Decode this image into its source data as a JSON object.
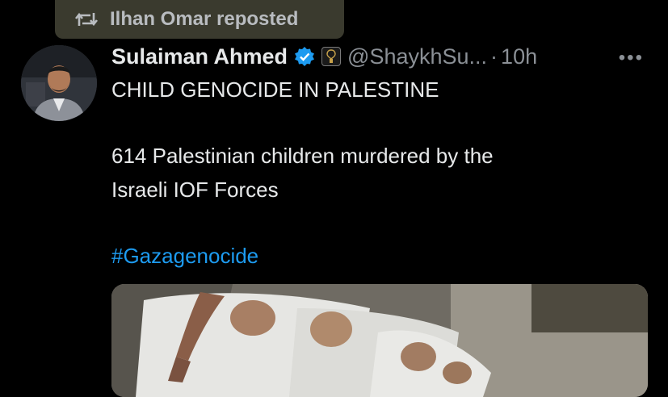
{
  "repost": {
    "label": "Ilhan Omar reposted",
    "icon": "repost-icon"
  },
  "author": {
    "name": "Sulaiman Ahmed",
    "handle": "@ShaykhSu...",
    "separator": "·",
    "time": "10h",
    "verified": true,
    "verified_color": "#1d9bf0"
  },
  "menu": {
    "more_label": "•••"
  },
  "post": {
    "line1": "CHILD GENOCIDE IN PALESTINE",
    "line2a": "614 Palestinian children murdered by the",
    "line2b": "Israeli IOF Forces",
    "hashtag": "#Gazagenocide"
  },
  "colors": {
    "background": "#000000",
    "text": "#e7e9ea",
    "muted": "#8b9096",
    "link": "#1d9bf0"
  }
}
